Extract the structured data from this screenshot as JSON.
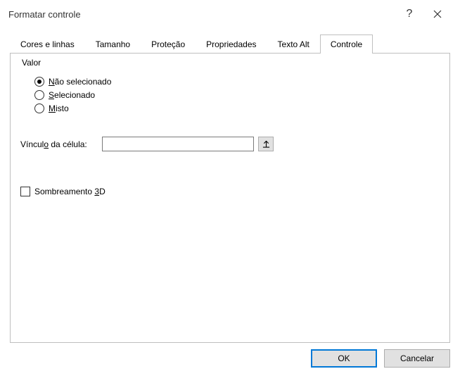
{
  "titlebar": {
    "title": "Formatar controle"
  },
  "tabs": {
    "items": [
      {
        "label": "Cores e linhas"
      },
      {
        "label": "Tamanho"
      },
      {
        "label": "Proteção"
      },
      {
        "label": "Propriedades"
      },
      {
        "label": "Texto Alt"
      },
      {
        "label": "Controle"
      }
    ]
  },
  "panel": {
    "group_label": "Valor",
    "radios": [
      {
        "prefix": "N",
        "rest": "ão selecionado",
        "selected": true
      },
      {
        "prefix": "S",
        "rest": "elecionado",
        "selected": false
      },
      {
        "prefix": "M",
        "rest": "isto",
        "selected": false
      }
    ],
    "cell_link": {
      "label_prefix": "Víncul",
      "label_u": "o",
      "label_rest": " da célula:",
      "value": ""
    },
    "shading": {
      "label_prefix": "Sombreamento ",
      "label_u": "3",
      "label_rest": "D",
      "checked": false
    }
  },
  "footer": {
    "ok": "OK",
    "cancel": "Cancelar"
  }
}
